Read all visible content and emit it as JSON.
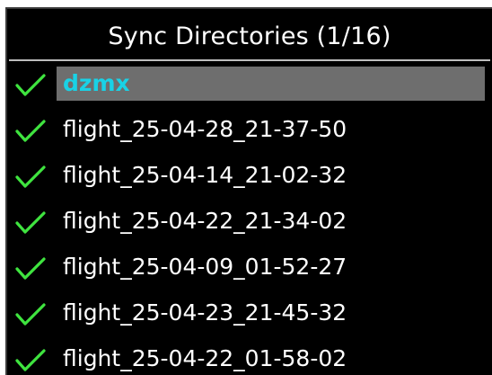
{
  "dialog": {
    "title": "Sync Directories (1/16)"
  },
  "colors": {
    "background": "#000000",
    "selected_row": "#6e6e6e",
    "selected_text": "#19d2e6",
    "check": "#3fe43f",
    "text": "#ffffff"
  },
  "directories": [
    {
      "name": "dzmx",
      "checked": true,
      "selected": true,
      "icon": "checkmark-icon"
    },
    {
      "name": "flight_25-04-28_21-37-50",
      "checked": true,
      "selected": false,
      "icon": "checkmark-icon"
    },
    {
      "name": "flight_25-04-14_21-02-32",
      "checked": true,
      "selected": false,
      "icon": "checkmark-icon"
    },
    {
      "name": "flight_25-04-22_21-34-02",
      "checked": true,
      "selected": false,
      "icon": "checkmark-icon"
    },
    {
      "name": "flight_25-04-09_01-52-27",
      "checked": true,
      "selected": false,
      "icon": "checkmark-icon"
    },
    {
      "name": "flight_25-04-23_21-45-32",
      "checked": true,
      "selected": false,
      "icon": "checkmark-icon"
    },
    {
      "name": "flight_25-04-22_01-58-02",
      "checked": true,
      "selected": false,
      "icon": "checkmark-icon"
    }
  ]
}
